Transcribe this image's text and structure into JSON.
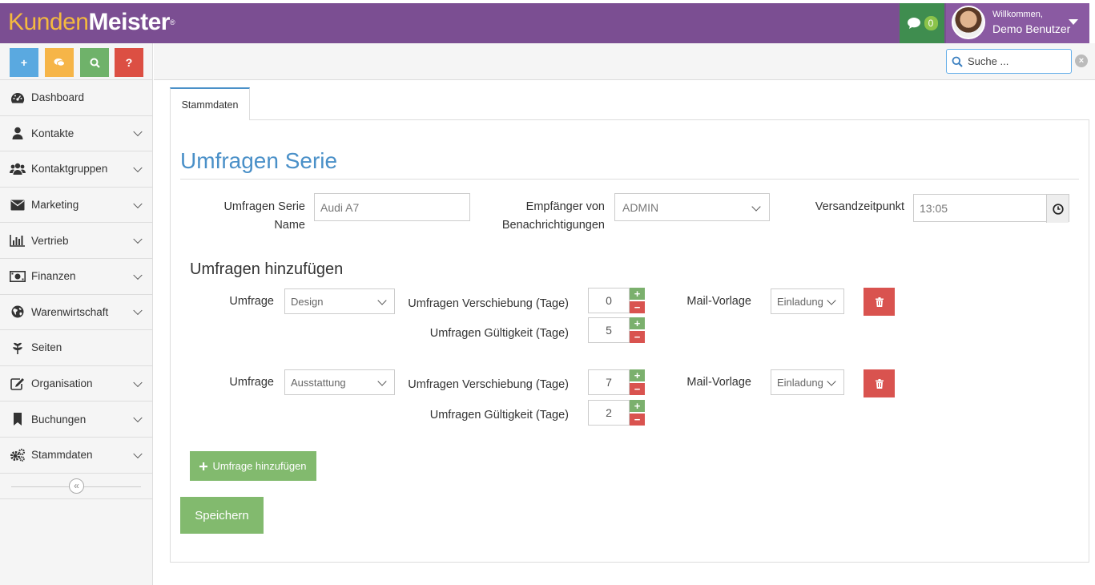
{
  "brand": {
    "part1": "Kunden",
    "part2": "Meister",
    "mark": "®"
  },
  "header": {
    "chat_count": "0",
    "welcome": "Willkommen,",
    "user_name": "Demo Benutzer"
  },
  "quick_buttons": [
    {
      "label": "+",
      "icon": "plus-icon",
      "color": "#5aa9e0"
    },
    {
      "label": "",
      "icon": "comments-icon",
      "color": "#f6b548"
    },
    {
      "label": "",
      "icon": "search-icon",
      "color": "#6fb26a"
    },
    {
      "label": "?",
      "icon": "help-icon",
      "color": "#dc4f43"
    }
  ],
  "search": {
    "placeholder": "Suche ..."
  },
  "sidebar": {
    "items": [
      {
        "label": "Dashboard",
        "icon": "dashboard-icon",
        "expandable": false
      },
      {
        "label": "Kontakte",
        "icon": "user-icon",
        "expandable": true
      },
      {
        "label": "Kontaktgruppen",
        "icon": "users-icon",
        "expandable": true
      },
      {
        "label": "Marketing",
        "icon": "envelope-icon",
        "expandable": true
      },
      {
        "label": "Vertrieb",
        "icon": "bar-chart-icon",
        "expandable": true
      },
      {
        "label": "Finanzen",
        "icon": "money-icon",
        "expandable": true
      },
      {
        "label": "Warenwirtschaft",
        "icon": "globe-icon",
        "expandable": true
      },
      {
        "label": "Seiten",
        "icon": "leaf-icon",
        "expandable": false
      },
      {
        "label": "Organisation",
        "icon": "edit-icon",
        "expandable": true
      },
      {
        "label": "Buchungen",
        "icon": "bookmark-icon",
        "expandable": true
      },
      {
        "label": "Stammdaten",
        "icon": "cogs-icon",
        "expandable": true
      }
    ],
    "collapse_label": "«"
  },
  "tab": {
    "label": "Stammdaten"
  },
  "form": {
    "title": "Umfragen Serie",
    "name_label_line1": "Umfragen Serie",
    "name_label_line2": "Name",
    "name_value": "Audi A7",
    "recipient_label_line1": "Empfänger von",
    "recipient_label_line2": "Benachrichtigungen",
    "recipient_value": "ADMIN",
    "send_time_label": "Versandzeitpunkt",
    "send_time_value": "13:05",
    "surveys_title": "Umfragen hinzufügen",
    "surveys": [
      {
        "survey_label": "Umfrage",
        "survey_value": "Design",
        "shift_label": "Umfragen Verschiebung (Tage)",
        "shift_value": "0",
        "validity_label": "Umfragen Gültigkeit (Tage)",
        "validity_value": "5",
        "mail_label": "Mail-Vorlage",
        "mail_value": "Einladung"
      },
      {
        "survey_label": "Umfrage",
        "survey_value": "Ausstattung",
        "shift_label": "Umfragen Verschiebung (Tage)",
        "shift_value": "7",
        "validity_label": "Umfragen Gültigkeit (Tage)",
        "validity_value": "2",
        "mail_label": "Mail-Vorlage",
        "mail_value": "Einladung"
      }
    ],
    "add_survey_label": "Umfrage hinzufügen",
    "save_label": "Speichern"
  }
}
